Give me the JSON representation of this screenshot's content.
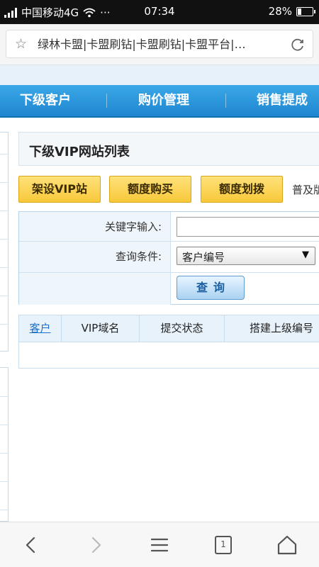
{
  "status_bar": {
    "carrier": "中国移动4G",
    "more": "···",
    "time": "07:34",
    "battery": "28%",
    "battery_level": 0.28
  },
  "address_bar": {
    "title": "绿林卡盟|卡盟刷钻|卡盟刷钻|卡盟平台|…"
  },
  "nav": {
    "items": [
      {
        "label": "下级客户"
      },
      {
        "label": "购价管理"
      },
      {
        "label": "销售提成"
      }
    ]
  },
  "main": {
    "title": "下级VIP网站列表",
    "buttons": [
      {
        "label": "架设VIP站"
      },
      {
        "label": "额度购买"
      },
      {
        "label": "额度划拨"
      }
    ],
    "overflow_text": "普及版"
  },
  "search": {
    "keyword_label": "关键字输入:",
    "keyword_value": "",
    "condition_label": "查询条件:",
    "condition_selected": "客户编号",
    "query_button": "查询"
  },
  "table": {
    "headers": [
      "客户",
      "VIP域名",
      "提交状态",
      "搭建上级编号"
    ]
  },
  "bottom_bar": {
    "tab_count": "1"
  },
  "colors": {
    "nav_blue": "#2196dd",
    "button_yellow": "#f8c83a",
    "link_blue": "#1b6fc9"
  }
}
